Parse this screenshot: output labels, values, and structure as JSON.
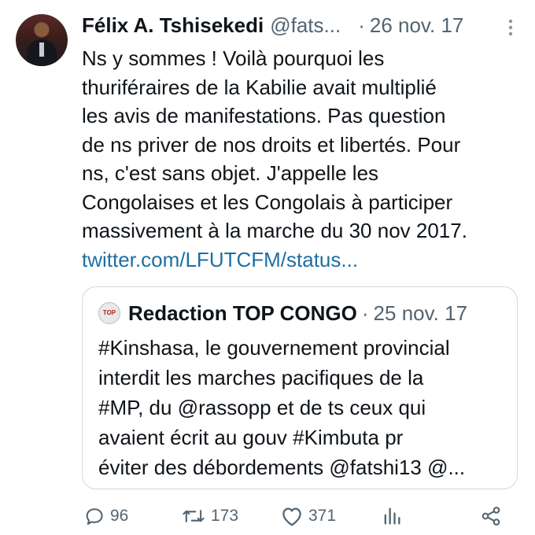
{
  "tweet": {
    "author_name": "Félix A. Tshisekedi",
    "handle": "@fats...",
    "separator": "·",
    "date": "26 nov. 17",
    "more_icon": "more-vertical-icon",
    "text_lines": [
      "Ns y sommes ! Voilà pourquoi les",
      "thuriféraires de la Kabilie avait multiplié",
      "les avis de manifestations. Pas question",
      "de ns priver de nos droits et libertés. Pour",
      "ns, c'est sans objet. J'appelle les",
      "Congolaises et les Congolais à participer",
      "massivement à la marche du 30 nov 2017."
    ],
    "link": "twitter.com/LFUTCFM/status..."
  },
  "quote": {
    "logo_text": "TOP",
    "author_name": "Redaction TOP CONGO",
    "separator": "·",
    "date": "25 nov. 17",
    "text_lines": [
      "#Kinshasa, le gouvernement provincial",
      "interdit les marches pacifiques de la",
      "#MP, du @rassopp et de ts ceux qui",
      "avaient écrit au gouv #Kimbuta pr",
      "éviter des débordements @fatshi13 @..."
    ]
  },
  "actions": {
    "reply_count": "96",
    "retweet_count": "173",
    "like_count": "371",
    "reply_icon": "reply-icon",
    "retweet_icon": "retweet-icon",
    "like_icon": "heart-icon",
    "views_icon": "analytics-icon",
    "share_icon": "share-icon"
  },
  "colors": {
    "link": "#1d6fa5",
    "secondary_text": "#536471",
    "border": "#cfd9de"
  }
}
